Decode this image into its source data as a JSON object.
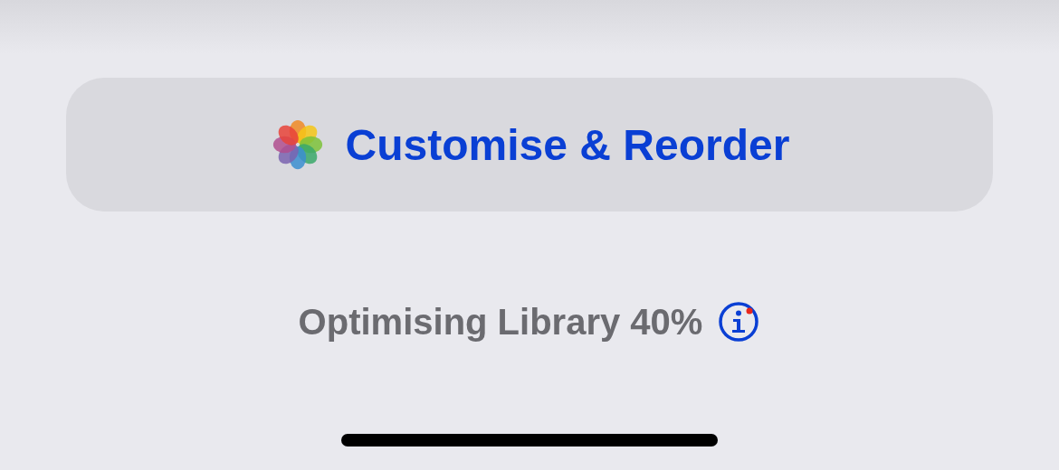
{
  "button": {
    "label": "Customise & Reorder"
  },
  "status": {
    "text": "Optimising Library 40%"
  }
}
